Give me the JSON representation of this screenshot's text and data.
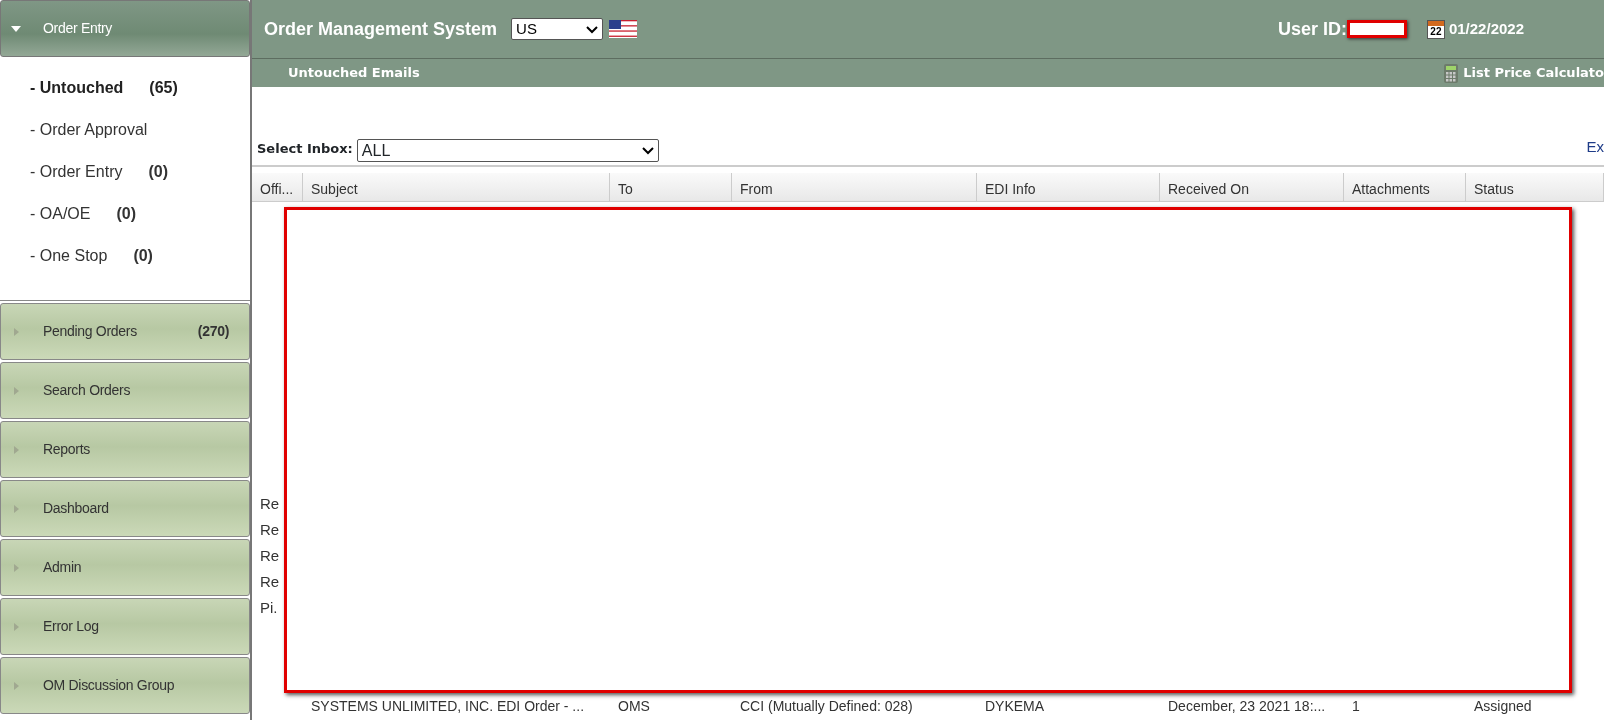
{
  "sidebar": {
    "sections": [
      {
        "label": "Order Entry",
        "expanded": true,
        "items": [
          {
            "label": "- Untouched",
            "count": "(65)",
            "selected": true
          },
          {
            "label": "- Order Approval",
            "selected": false
          },
          {
            "label": "- Order Entry",
            "count": "(0)",
            "selected": false
          },
          {
            "label": "- OA/OE",
            "count": "(0)",
            "selected": false
          },
          {
            "label": "- One Stop",
            "count": "(0)",
            "selected": false
          }
        ]
      },
      {
        "label": "Pending Orders",
        "count": "(270)",
        "expanded": false
      },
      {
        "label": "Search Orders",
        "expanded": false
      },
      {
        "label": "Reports",
        "expanded": false
      },
      {
        "label": "Dashboard",
        "expanded": false
      },
      {
        "label": "Admin",
        "expanded": false
      },
      {
        "label": "Error Log",
        "expanded": false
      },
      {
        "label": "OM Discussion Group",
        "expanded": false
      }
    ]
  },
  "header": {
    "title": "Order Management System",
    "region": "US",
    "user_id_label": "User ID:",
    "calendar_day": "22",
    "date": "01/22/2022"
  },
  "subheader": {
    "title": "Untouched Emails",
    "tool": "List Price Calculato"
  },
  "inbox": {
    "label": "Select Inbox:",
    "value": "ALL",
    "link": "Ex"
  },
  "table": {
    "columns": [
      "Offi...",
      "Subject",
      "To",
      "From",
      "EDI Info",
      "Received On",
      "Attachments",
      "Status"
    ],
    "rows": [
      {
        "office": "Re"
      },
      {
        "office": "Re"
      },
      {
        "office": "Re"
      },
      {
        "office": "Re"
      },
      {
        "office": "Pi."
      },
      {
        "cells": [
          "",
          "SYSTEMS UNLIMITED, INC. EDI Order - ...",
          "OMS",
          "CCI (Mutually Defined: 028)",
          "DYKEMA",
          "December, 23 2021 18:...",
          "1",
          "Assigned"
        ]
      }
    ]
  }
}
